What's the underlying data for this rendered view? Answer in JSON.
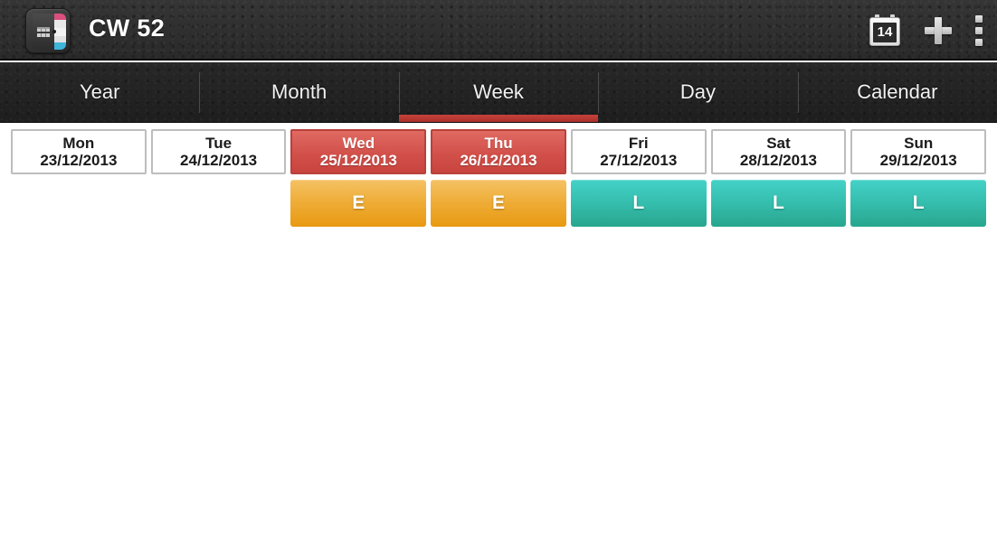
{
  "titlebar": {
    "title": "CW 52",
    "app_icon_name": "organizer-book-icon",
    "actions": [
      {
        "name": "calendar-icon",
        "label": "14"
      },
      {
        "name": "add-icon",
        "label": "+"
      },
      {
        "name": "overflow-menu-icon",
        "label": "⋮"
      }
    ]
  },
  "tabs": [
    {
      "label": "Year",
      "active": false
    },
    {
      "label": "Month",
      "active": false
    },
    {
      "label": "Week",
      "active": true
    },
    {
      "label": "Day",
      "active": false
    },
    {
      "label": "Calendar",
      "active": false
    }
  ],
  "colors": {
    "accent_red": "#c8423c",
    "holiday_red": "#d2504a",
    "shift_early_orange": "#efae3a",
    "shift_late_teal": "#35bdad",
    "titlebar_dark": "#2e2e2e",
    "tabbar_dark": "#232323"
  },
  "week": {
    "days": [
      {
        "dow": "Mon",
        "date": "23/12/2013",
        "holiday": false,
        "shift": {
          "code": "",
          "type": "none"
        }
      },
      {
        "dow": "Tue",
        "date": "24/12/2013",
        "holiday": false,
        "shift": {
          "code": "",
          "type": "none"
        }
      },
      {
        "dow": "Wed",
        "date": "25/12/2013",
        "holiday": true,
        "shift": {
          "code": "E",
          "type": "early"
        }
      },
      {
        "dow": "Thu",
        "date": "26/12/2013",
        "holiday": true,
        "shift": {
          "code": "E",
          "type": "early"
        }
      },
      {
        "dow": "Fri",
        "date": "27/12/2013",
        "holiday": false,
        "shift": {
          "code": "L",
          "type": "late"
        }
      },
      {
        "dow": "Sat",
        "date": "28/12/2013",
        "holiday": false,
        "shift": {
          "code": "L",
          "type": "late"
        }
      },
      {
        "dow": "Sun",
        "date": "29/12/2013",
        "holiday": false,
        "shift": {
          "code": "L",
          "type": "late"
        }
      }
    ]
  }
}
